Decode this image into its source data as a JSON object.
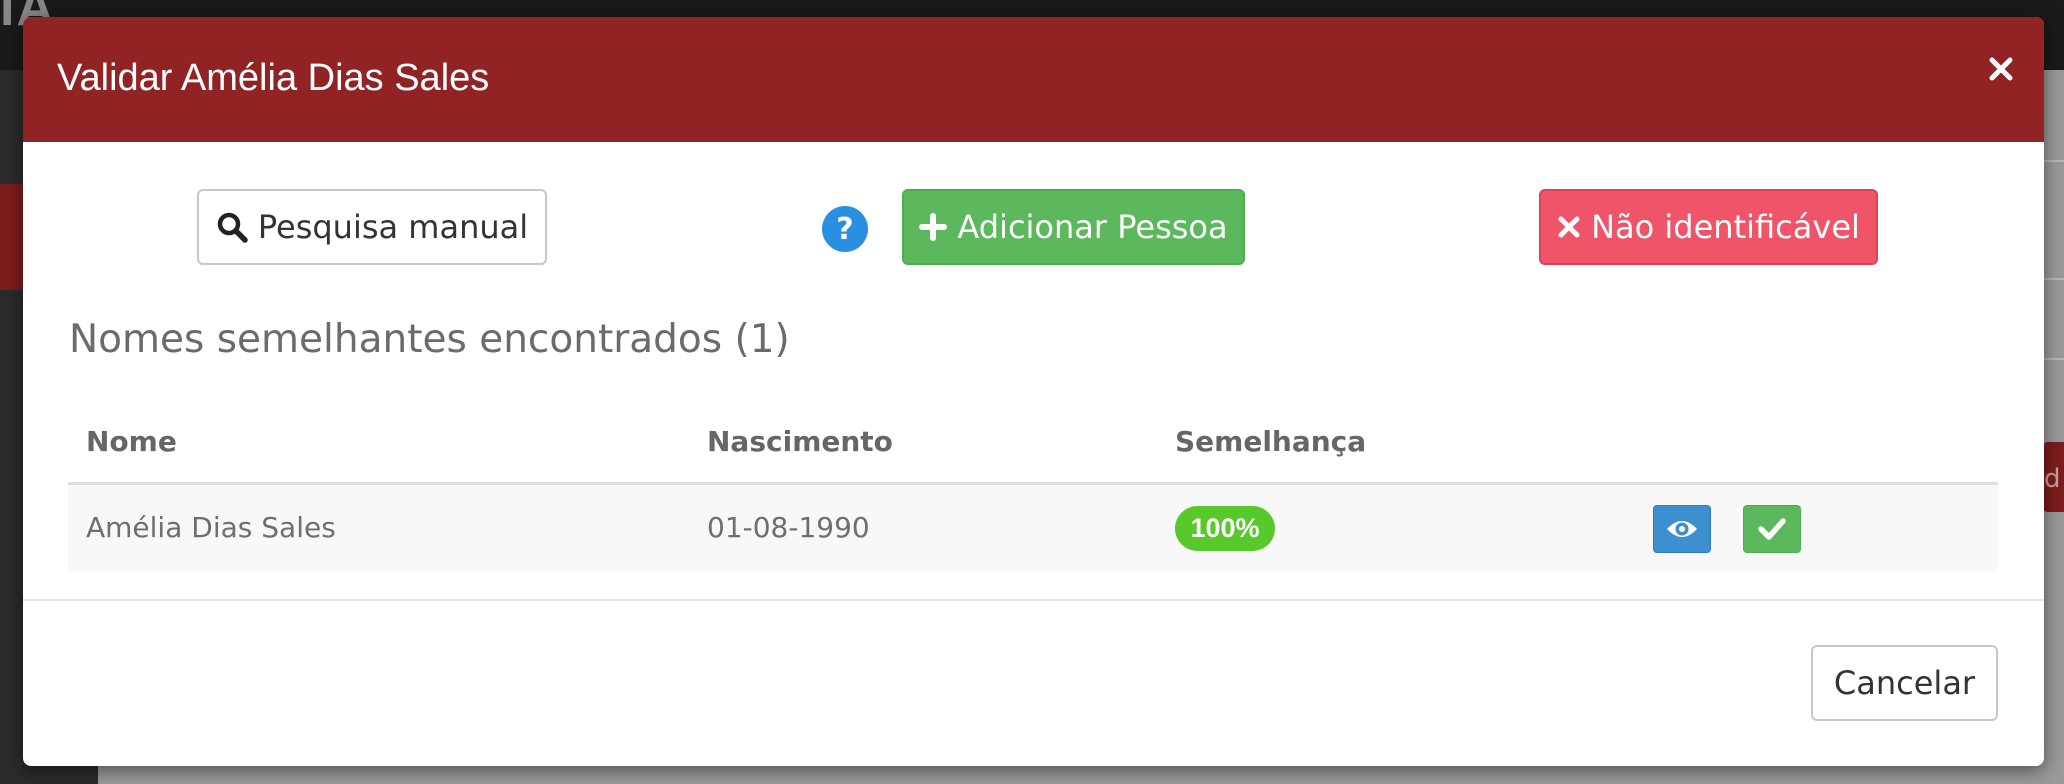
{
  "background": {
    "logo_text": "IA",
    "right_button_fragment": "d"
  },
  "modal": {
    "title": "Validar Amélia Dias Sales",
    "header_color": "#912325"
  },
  "actions": {
    "manual_search_label": "Pesquisa manual",
    "add_person_label": "Adicionar Pessoa",
    "not_identifiable_label": "Não identificável"
  },
  "results": {
    "section_title": "Nomes semelhantes encontrados (1)",
    "columns": [
      "Nome",
      "Nascimento",
      "Semelhança"
    ],
    "rows": [
      {
        "name": "Amélia Dias Sales",
        "birth": "01-08-1990",
        "similarity": "100%"
      }
    ]
  },
  "footer": {
    "cancel_label": "Cancelar"
  },
  "icons": {
    "close": "close-icon",
    "search": "search-icon",
    "help": "question-circle-icon",
    "add": "plus-icon",
    "not_identifiable": "times-icon",
    "view": "eye-icon",
    "accept": "check-icon"
  },
  "colors": {
    "success": "#5cb85c",
    "danger": "#ef5468",
    "info": "#3d8fcf",
    "badge": "#58c92a",
    "help": "#2a8fe0"
  }
}
